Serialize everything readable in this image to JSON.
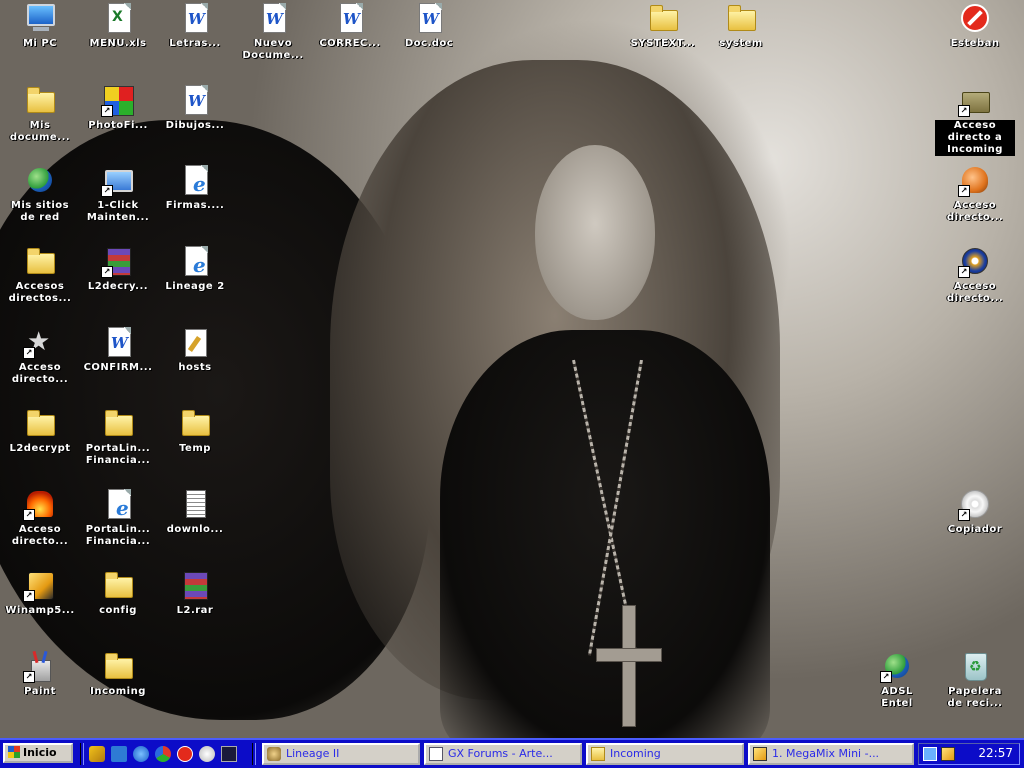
{
  "desktop_icons": [
    {
      "id": "mi-pc",
      "label": "Mi PC",
      "shape": "monitor",
      "shortcut": false
    },
    {
      "id": "menu-xls",
      "label": "MENU.xls",
      "shape": "excel-doc",
      "shortcut": false
    },
    {
      "id": "letras",
      "label": "Letras...",
      "shape": "word-doc",
      "shortcut": false
    },
    {
      "id": "nuevo-documento",
      "label": "Nuevo\nDocume...",
      "shape": "word-doc",
      "shortcut": false
    },
    {
      "id": "correc",
      "label": "CORREC...",
      "shape": "word-doc",
      "shortcut": false
    },
    {
      "id": "doc-doc",
      "label": "Doc.doc",
      "shape": "word-doc",
      "shortcut": false
    },
    {
      "id": "systext",
      "label": "SYSTEXT...",
      "shape": "folder",
      "shortcut": false
    },
    {
      "id": "system",
      "label": "system",
      "shape": "folder",
      "shortcut": false
    },
    {
      "id": "esteban",
      "label": "Esteban",
      "shape": "stop",
      "shortcut": false
    },
    {
      "id": "mis-documentos",
      "label": "Mis\ndocume...",
      "shape": "folder",
      "shortcut": false
    },
    {
      "id": "photofiltre",
      "label": "PhotoFi...",
      "shape": "palette",
      "shortcut": true
    },
    {
      "id": "dibujos",
      "label": "Dibujos...",
      "shape": "word-doc",
      "shortcut": false
    },
    {
      "id": "acceso-incoming",
      "label": "Acceso\ndirecto a\nIncoming",
      "shape": "dark-folder",
      "shortcut": true,
      "selected": true
    },
    {
      "id": "mis-sitios-red",
      "label": "Mis sitios\nde red",
      "shape": "globe",
      "shortcut": false
    },
    {
      "id": "1-click",
      "label": "1-Click\nMainten...",
      "shape": "pc",
      "shortcut": true
    },
    {
      "id": "firmas",
      "label": "Firmas....",
      "shape": "ie",
      "shortcut": false
    },
    {
      "id": "acceso-directo-kitten",
      "label": "Acceso\ndirecto...",
      "shape": "kitten",
      "shortcut": true
    },
    {
      "id": "accesos-directos",
      "label": "Accesos\ndirectos...",
      "shape": "folder",
      "shortcut": false
    },
    {
      "id": "l2decrypt-exe",
      "label": "L2decry...",
      "shape": "zip",
      "shortcut": true
    },
    {
      "id": "lineage2",
      "label": "Lineage 2",
      "shape": "ie",
      "shortcut": false
    },
    {
      "id": "acceso-directo-media",
      "label": "Acceso\ndirecto...",
      "shape": "media",
      "shortcut": true
    },
    {
      "id": "acceso-directo-star",
      "label": "Acceso\ndirecto...",
      "shape": "star",
      "shortcut": true
    },
    {
      "id": "confirm",
      "label": "CONFIRM...",
      "shape": "word-doc",
      "shortcut": false
    },
    {
      "id": "hosts",
      "label": "hosts",
      "shape": "pen",
      "shortcut": false
    },
    {
      "id": "l2decrypt",
      "label": "L2decrypt",
      "shape": "folder",
      "shortcut": false
    },
    {
      "id": "portalin-1",
      "label": "PortaLin...\nFinancia...",
      "shape": "folder",
      "shortcut": false
    },
    {
      "id": "temp",
      "label": "Temp",
      "shape": "folder",
      "shortcut": false
    },
    {
      "id": "acceso-directo-fire",
      "label": "Acceso\ndirecto...",
      "shape": "fire",
      "shortcut": true
    },
    {
      "id": "portalin-2",
      "label": "PortaLin...\nFinancia...",
      "shape": "ie",
      "shortcut": false
    },
    {
      "id": "downlo",
      "label": "downlo...",
      "shape": "text-doc",
      "shortcut": false
    },
    {
      "id": "copiador",
      "label": "Copiador",
      "shape": "disc",
      "shortcut": true
    },
    {
      "id": "winamp",
      "label": "Winamp5...",
      "shape": "winamp",
      "shortcut": true
    },
    {
      "id": "config",
      "label": "config",
      "shape": "folder",
      "shortcut": false
    },
    {
      "id": "l2-rar",
      "label": "L2.rar",
      "shape": "zip",
      "shortcut": false
    },
    {
      "id": "paint",
      "label": "Paint",
      "shape": "paint",
      "shortcut": true
    },
    {
      "id": "incoming",
      "label": "Incoming",
      "shape": "folder",
      "shortcut": false
    },
    {
      "id": "adsl-entel",
      "label": "ADSL\nEntel",
      "shape": "globe",
      "shortcut": true
    },
    {
      "id": "papelera",
      "label": "Papelera\nde reci...",
      "shape": "recycle",
      "shortcut": false
    }
  ],
  "taskbar": {
    "start_label": "Inicio",
    "quick_launch": [
      "kazaa-icon",
      "outlook-icon",
      "ie-icon",
      "msn-icon",
      "stop-icon",
      "winamp-icon",
      "tool-icon"
    ],
    "tasks": [
      {
        "label": "Lineage II",
        "icon": "game-icon"
      },
      {
        "label": "GX Forums - Arte...",
        "icon": "word-icon"
      },
      {
        "label": "Incoming",
        "icon": "folder-icon"
      },
      {
        "label": "1. MegaMix Mini -...",
        "icon": "winamp-icon"
      }
    ],
    "tray_icons": [
      "network-icon",
      "winamp-tray-icon"
    ],
    "clock": "22:57"
  },
  "colors": {
    "taskbar_bg": "#0c0cc8",
    "task_text": "#2a2ae8",
    "icon_label": "#ffffff"
  }
}
